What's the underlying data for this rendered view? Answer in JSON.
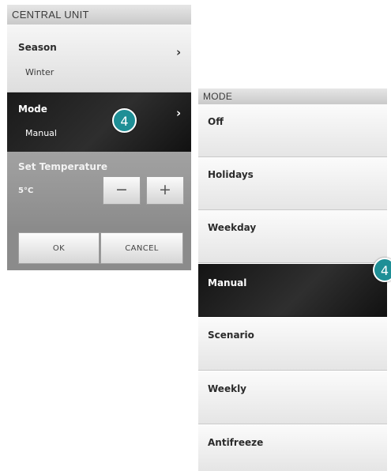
{
  "central_unit": {
    "title": "CENTRAL UNIT",
    "season": {
      "label": "Season",
      "value": "Winter"
    },
    "mode": {
      "label": "Mode",
      "value": "Manual"
    },
    "temperature": {
      "label": "Set Temperature",
      "value": "5°C",
      "minus": "−",
      "plus": "+"
    },
    "ok_label": "OK",
    "cancel_label": "CANCEL",
    "chevron": "›",
    "badge": "4"
  },
  "mode_panel": {
    "title": "MODE",
    "items": [
      "Off",
      "Holidays",
      "Weekday",
      "Manual",
      "Scenario",
      "Weekly",
      "Antifreeze"
    ],
    "selected": "Manual",
    "badge": "4"
  }
}
